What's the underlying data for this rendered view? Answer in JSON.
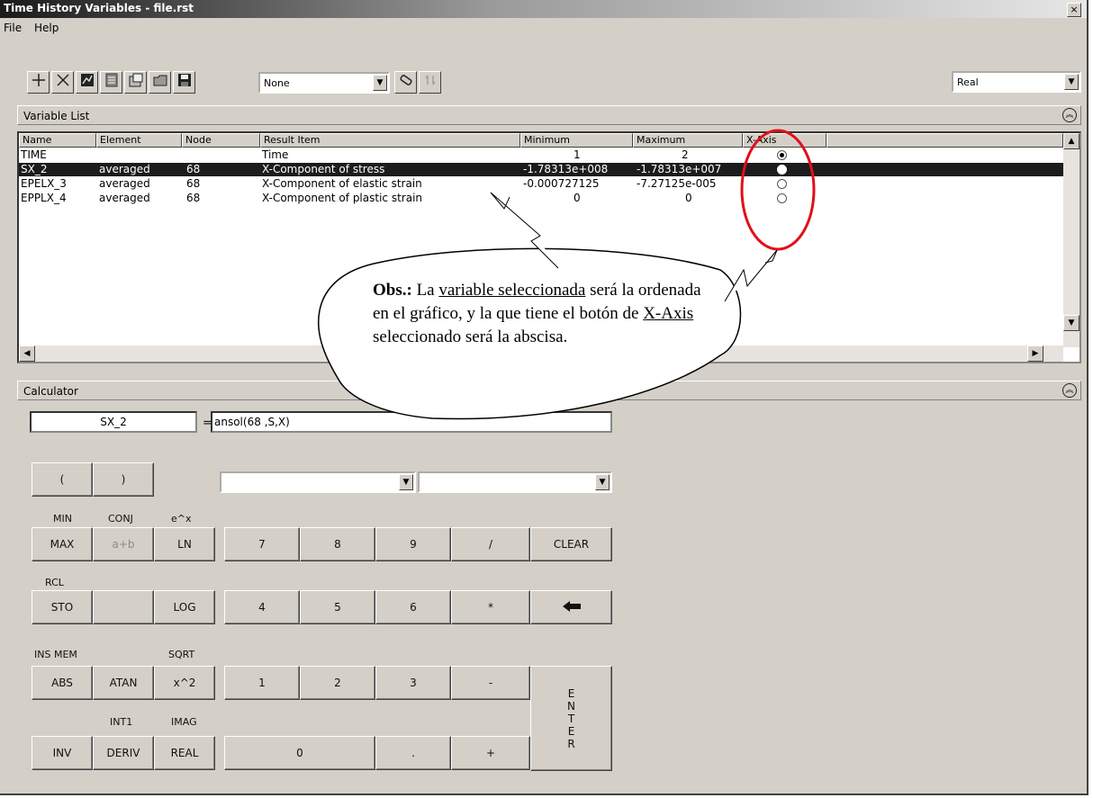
{
  "window": {
    "title": "Time History Variables - file.rst",
    "close_glyph": "×"
  },
  "menu": {
    "file": "File",
    "help": "Help"
  },
  "toolbar": {
    "icons": [
      "add-icon",
      "delete-icon",
      "graph-icon",
      "list-icon",
      "properties-icon",
      "import-icon",
      "save-icon",
      "clear-icon",
      "refresh-icon"
    ],
    "combo_value": "None",
    "complex_mode": "Real"
  },
  "variable_list": {
    "title": "Variable List",
    "columns": [
      "Name",
      "Element",
      "Node",
      "Result Item",
      "Minimum",
      "Maximum",
      "X-Axis"
    ],
    "rows": [
      {
        "name": "TIME",
        "element": "",
        "node": "",
        "item": "Time",
        "min": "1",
        "max": "2",
        "xaxis": true
      },
      {
        "name": "SX_2",
        "element": "averaged",
        "node": "68",
        "item": "X-Component of stress",
        "min": "-1.78313e+008",
        "max": "-1.78313e+007",
        "xaxis": false
      },
      {
        "name": "EPELX_3",
        "element": "averaged",
        "node": "68",
        "item": "X-Component of elastic strain",
        "min": "-0.000727125",
        "max": "-7.27125e-005",
        "xaxis": false
      },
      {
        "name": "EPPLX_4",
        "element": "averaged",
        "node": "68",
        "item": "X-Component of plastic strain",
        "min": "0",
        "max": "0",
        "xaxis": false
      }
    ],
    "selected_index": 1
  },
  "calculator": {
    "title": "Calculator",
    "var_name": "SX_2",
    "equals": "=",
    "expression": "ansol(68 ,S,X)",
    "labels": {
      "min": "MIN",
      "conj": "CONJ",
      "exp": "e^x",
      "rcl": "RCL",
      "ins_mem": "INS MEM",
      "sqrt": "SQRT",
      "int1": "INT1",
      "imag": "IMAG"
    },
    "buttons": {
      "lparen": "(",
      "rparen": ")",
      "max": "MAX",
      "aplusb": "a+b",
      "ln": "LN",
      "b7": "7",
      "b8": "8",
      "b9": "9",
      "div": "/",
      "clear": "CLEAR",
      "sto": "STO",
      "log": "LOG",
      "b4": "4",
      "b5": "5",
      "b6": "6",
      "mul": "*",
      "abs": "ABS",
      "atan": "ATAN",
      "sq": "x^2",
      "b1": "1",
      "b2": "2",
      "b3": "3",
      "minus": "-",
      "inv": "INV",
      "deriv": "DERIV",
      "real": "REAL",
      "b0": "0",
      "dot": ".",
      "plus": "+",
      "enter": "E N T E R"
    }
  },
  "callout": {
    "obs": "Obs.:",
    "t1": " La ",
    "t2": "variable seleccionada",
    "t3": " será la ordenada en el gráfico, y la que tiene el botón de ",
    "t4": "X-Axis",
    "t5": " seleccionado será la abscisa."
  },
  "colors": {
    "annotation_red": "#e0101a",
    "selection": "#1c1c1c",
    "face": "#d4d0c8"
  }
}
